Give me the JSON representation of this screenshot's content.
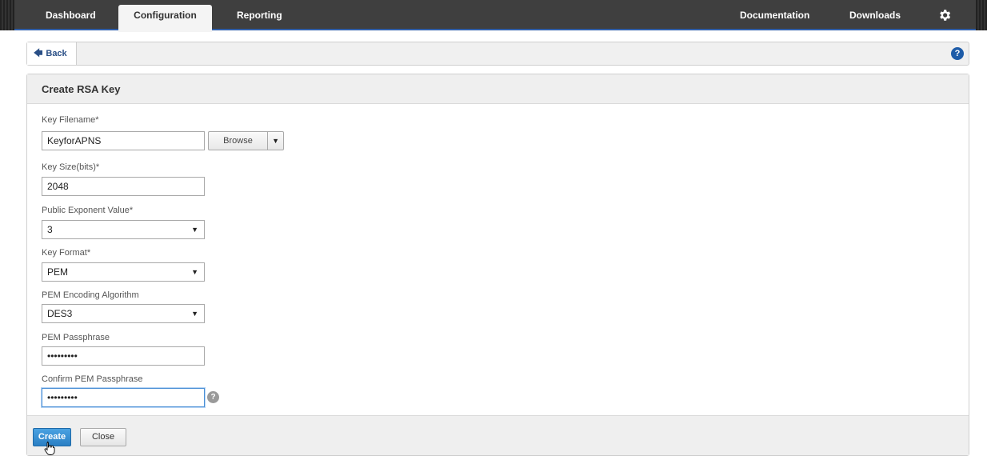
{
  "topnav": {
    "tabs": [
      {
        "label": "Dashboard"
      },
      {
        "label": "Configuration"
      },
      {
        "label": "Reporting"
      }
    ],
    "right": {
      "documentation": "Documentation",
      "downloads": "Downloads"
    },
    "settings_icon": "gear-icon"
  },
  "backbar": {
    "back_label": "Back",
    "back_icon": "arrow-left-icon",
    "help_icon": "help-icon",
    "help_glyph": "?"
  },
  "panel": {
    "title": "Create RSA Key",
    "fields": {
      "key_filename": {
        "label": "Key Filename*",
        "value": "KeyforAPNS",
        "browse_label": "Browse"
      },
      "key_size": {
        "label": "Key Size(bits)*",
        "value": "2048"
      },
      "public_exponent": {
        "label": "Public Exponent Value*",
        "value": "3"
      },
      "key_format": {
        "label": "Key Format*",
        "value": "PEM"
      },
      "pem_encoding": {
        "label": "PEM Encoding Algorithm",
        "value": "DES3"
      },
      "pem_passphrase": {
        "label": "PEM Passphrase",
        "value": "•••••••••"
      },
      "confirm_passphrase": {
        "label": "Confirm PEM Passphrase",
        "value": "•••••••••",
        "help_glyph": "?"
      }
    },
    "buttons": {
      "create": "Create",
      "close": "Close"
    }
  },
  "colors": {
    "nav_bg": "#3f3f3f",
    "accent": "#2f5ea8",
    "create_button": "#2a7fc4"
  }
}
